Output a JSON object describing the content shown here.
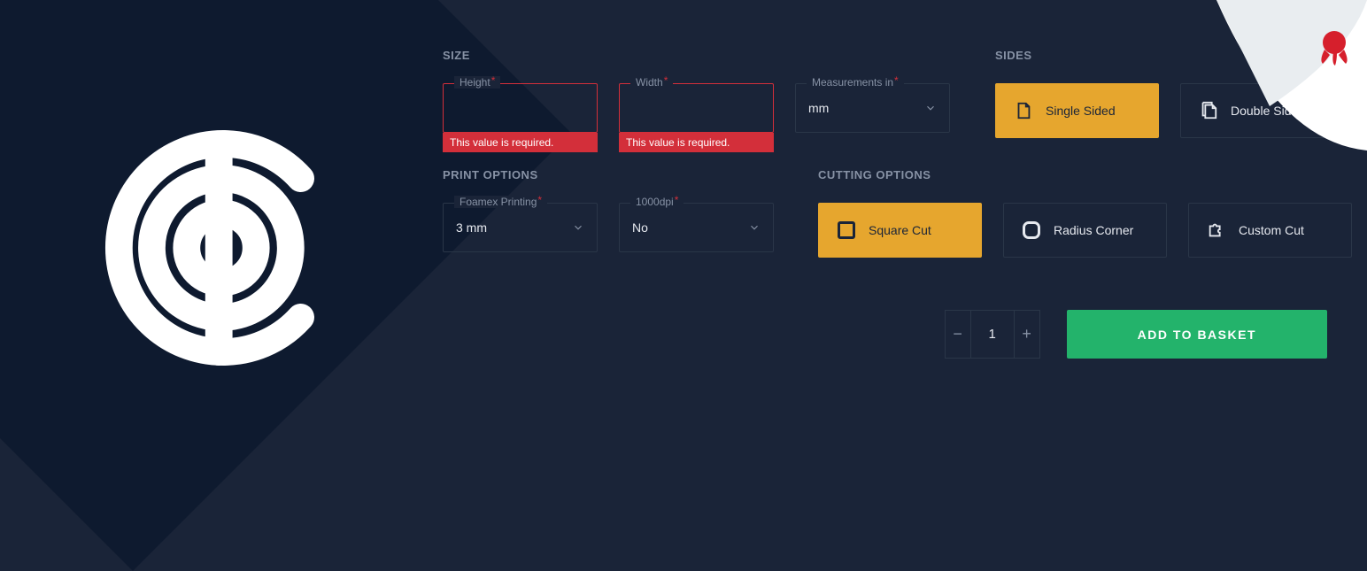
{
  "sections": {
    "size": {
      "title": "SIZE",
      "height_label": "Height",
      "width_label": "Width",
      "height_error": "This value is required.",
      "width_error": "This value is required.",
      "meas_label": "Measurements in",
      "meas_value": "mm"
    },
    "sides": {
      "title": "SIDES",
      "single_label": "Single Sided",
      "double_label": "Double Sided"
    },
    "print": {
      "title": "PRINT OPTIONS",
      "foamex_label": "Foamex Printing",
      "foamex_value": "3 mm",
      "dpi_label": "1000dpi",
      "dpi_value": "No"
    },
    "cutting": {
      "title": "CUTTING OPTIONS",
      "square_label": "Square Cut",
      "radius_label": "Radius Corner",
      "custom_label": "Custom Cut"
    }
  },
  "footer": {
    "quantity": "1",
    "add_label": "ADD TO BASKET"
  }
}
